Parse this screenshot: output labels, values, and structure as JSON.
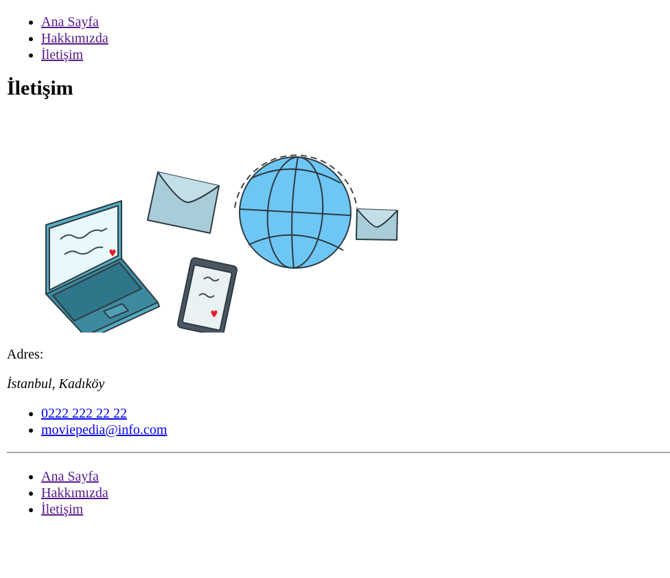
{
  "nav": {
    "items": [
      {
        "label": "Ana Sayfa"
      },
      {
        "label": "Hakkımızda"
      },
      {
        "label": "İletişim"
      }
    ]
  },
  "page": {
    "title": "İletişim"
  },
  "illustration": {
    "icons": [
      "laptop-icon",
      "envelope-icon",
      "phone-icon",
      "globe-icon",
      "envelope-small-icon"
    ],
    "colors": {
      "globe": "#6ec6f5",
      "laptop": "#4fa8bf",
      "envelope": "#a8cdd9",
      "heart": "#e51c23"
    }
  },
  "contact": {
    "address_label": "Adres:",
    "address_value": "İstanbul, Kadıköy",
    "phone": "0222 222 22 22",
    "email": "moviepedia@info.com"
  },
  "footer": {
    "items": [
      {
        "label": "Ana Sayfa"
      },
      {
        "label": "Hakkımızda"
      },
      {
        "label": "İletişim"
      }
    ]
  }
}
